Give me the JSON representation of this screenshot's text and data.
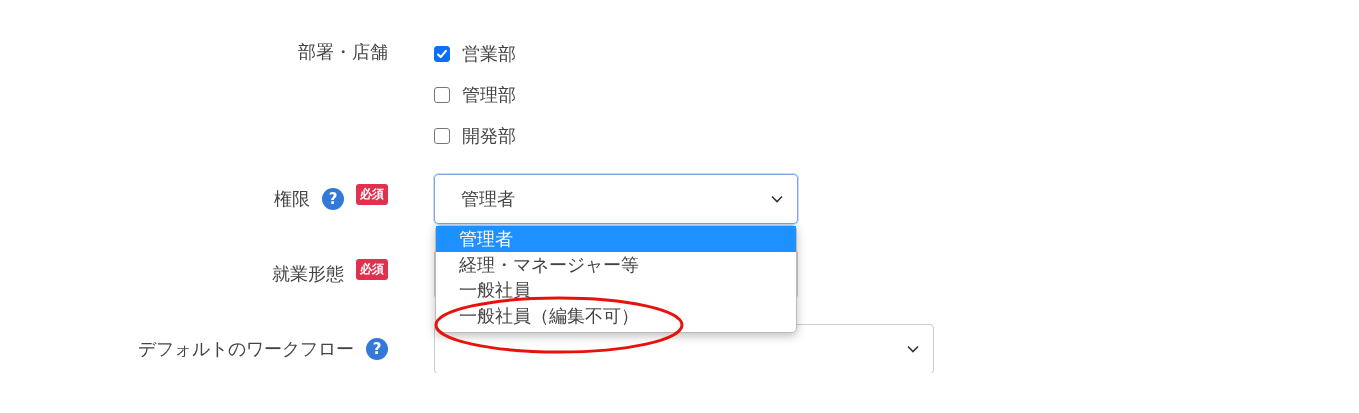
{
  "department": {
    "label": "部署・店舗",
    "options": [
      {
        "label": "営業部",
        "checked": true
      },
      {
        "label": "管理部",
        "checked": false
      },
      {
        "label": "開発部",
        "checked": false
      }
    ]
  },
  "fields": [
    {
      "label": "権限",
      "help": "?",
      "badge": "必須",
      "value": "管理者",
      "focused": true,
      "open": true
    },
    {
      "label": "就業形態",
      "badge": "必須",
      "focused": false,
      "open": false
    },
    {
      "label": "デフォルトのワークフロー",
      "help": "?",
      "focused": false,
      "open": false,
      "wide": true
    }
  ],
  "dropdown": {
    "options": [
      {
        "label": "管理者",
        "selected": true,
        "circled": false
      },
      {
        "label": "経理・マネージャー等",
        "selected": false,
        "circled": false
      },
      {
        "label": "一般社員",
        "selected": false,
        "circled": false
      },
      {
        "label": "一般社員（編集不可）",
        "selected": false,
        "circled": true
      }
    ]
  }
}
